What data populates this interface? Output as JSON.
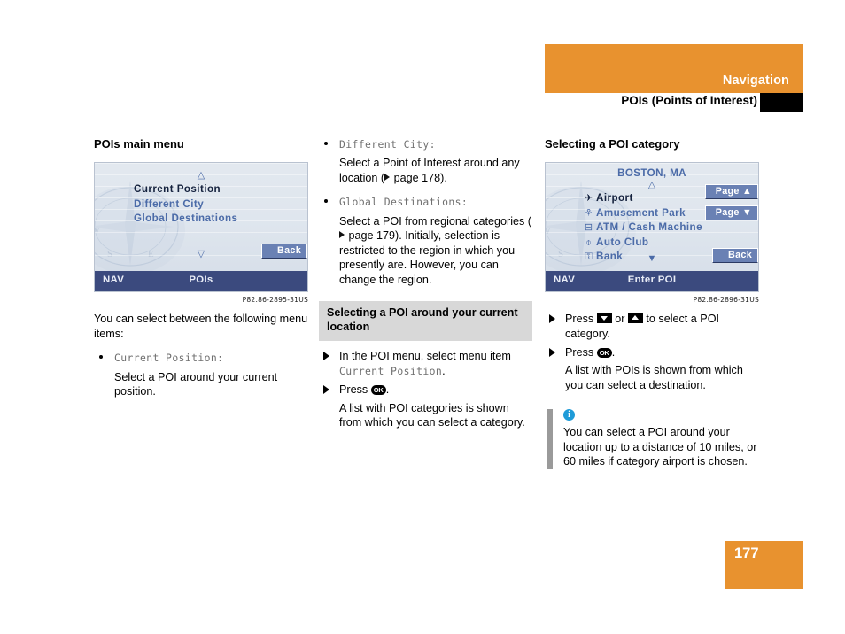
{
  "header": {
    "title": "Navigation",
    "subtitle": "POIs (Points of Interest)",
    "bar_color": "#e8922f",
    "thumb_color": "#000000"
  },
  "footer": {
    "page_number": "177"
  },
  "columns": {
    "left": {
      "heading": "POIs main menu",
      "screenshot": {
        "title": "",
        "up_arrow": "△",
        "down_arrow": "▽",
        "items": [
          {
            "icon": "",
            "label": "Current Position",
            "selected": true
          },
          {
            "icon": "",
            "label": "Different City",
            "selected": false
          },
          {
            "icon": "",
            "label": "Global Destinations",
            "selected": false
          }
        ],
        "buttons": [
          {
            "label": "Back",
            "name": "back-button"
          }
        ],
        "footer_left": "NAV",
        "footer_center": "POIs",
        "caption_code": "P82.86-2895-31US"
      },
      "intro": "You can select between the following menu items:",
      "bullets": [
        {
          "term": "Current Position:",
          "desc": "Select a POI around your current position."
        }
      ]
    },
    "middle": {
      "bullets": [
        {
          "term": "Different City:",
          "desc_pre": "Select a Point of Interest around any location (",
          "desc_post": " page 178)."
        },
        {
          "term": "Global Destinations:",
          "desc_pre": "Select a POI from regional categories (",
          "desc_post": " page 179). Initially, selection is restricted to the region in which you presently are. However, you can change the region."
        }
      ],
      "subheading": "Selecting a POI around your current location",
      "steps": [
        {
          "pre": "In the POI menu, select menu item ",
          "mono": "Current Position",
          "post": "."
        },
        {
          "pre": "Press ",
          "key": "OK",
          "post": "."
        }
      ],
      "result": "A list with POI categories is shown from which you can select a category."
    },
    "right": {
      "heading": "Selecting a POI category",
      "screenshot": {
        "title": "BOSTON, MA",
        "up_arrow": "△",
        "down_arrow": "▼",
        "items": [
          {
            "icon": "airport-icon",
            "glyph": "✈",
            "label": "Airport",
            "selected": true
          },
          {
            "icon": "amusement-park-icon",
            "glyph": "⚘",
            "label": "Amusement Park",
            "selected": false
          },
          {
            "icon": "atm-icon",
            "glyph": "⊟",
            "label": "ATM / Cash Machine",
            "selected": false
          },
          {
            "icon": "auto-club-icon",
            "glyph": "⌽",
            "label": "Auto Club",
            "selected": false
          },
          {
            "icon": "bank-icon",
            "glyph": "⚿",
            "label": "Bank",
            "selected": false
          }
        ],
        "buttons": [
          {
            "label": "Page ▲",
            "name": "page-up-button"
          },
          {
            "label": "Page ▼",
            "name": "page-down-button"
          },
          {
            "label": "Back",
            "name": "back-button"
          }
        ],
        "footer_left": "NAV",
        "footer_center": "Enter POI",
        "caption_code": "P82.86-2896-31US"
      },
      "steps": [
        {
          "pre": "Press ",
          "key_down": "▼",
          "mid": " or ",
          "key_up": "▲",
          "post": " to select a POI category."
        },
        {
          "pre": "Press ",
          "key": "OK",
          "post": "."
        }
      ],
      "result": "A list with POIs is shown from which you can select a destination.",
      "note": {
        "icon": "info-icon",
        "icon_glyph": "i",
        "text": "You can select a POI around your location up to a distance of 10 miles, or 60 miles if category airport is chosen."
      }
    }
  }
}
